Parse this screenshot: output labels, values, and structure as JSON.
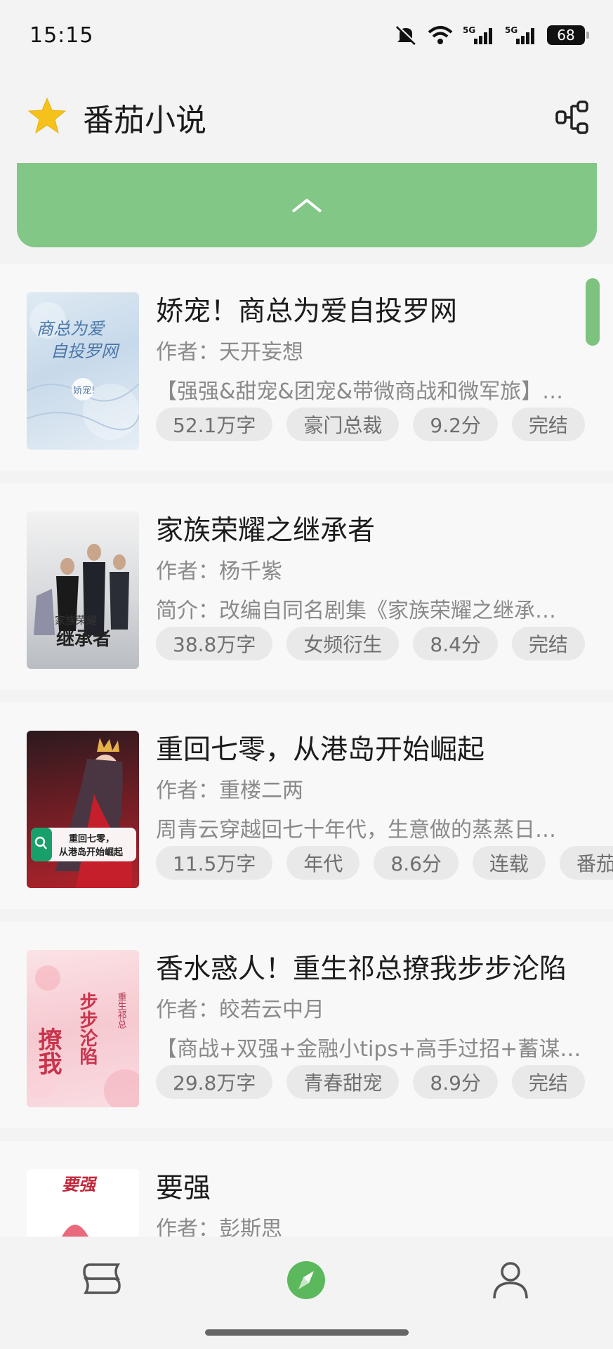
{
  "status_bar": {
    "time": "15:15",
    "battery": "68",
    "network_label_1": "5G",
    "network_label_2": "5G"
  },
  "header": {
    "app_title": "番茄小说",
    "logo_icon": "star-icon",
    "share_icon": "share-icon"
  },
  "banner": {
    "icon": "chevron-up-icon"
  },
  "books": [
    {
      "title": "娇宠！商总为爱自投罗网",
      "author": "作者：天开妄想",
      "description": "【强强&甜宠&团宠&带微商战和微军旅】…",
      "tags": [
        "52.1万字",
        "豪门总裁",
        "9.2分",
        "完结"
      ],
      "cover_text_1": "商总为爱",
      "cover_text_2": "自投罗网",
      "cover_text_3": "娇宠!"
    },
    {
      "title": "家族荣耀之继承者",
      "author": "作者：杨千紫",
      "description": "简介：改编自同名剧集《家族荣耀之继承…",
      "tags": [
        "38.8万字",
        "女频衍生",
        "8.4分",
        "完结"
      ],
      "cover_text_1": "家族荣耀",
      "cover_text_2": "继承者"
    },
    {
      "title": "重回七零，从港岛开始崛起",
      "author": "作者：重楼二两",
      "description": "周青云穿越回七十年代，生意做的蒸蒸日…",
      "tags": [
        "11.5万字",
        "年代",
        "8.6分",
        "连载",
        "番茄"
      ],
      "cover_text_1": "重回七零，",
      "cover_text_2": "从港岛开始崛起"
    },
    {
      "title": "香水惑人！重生祁总撩我步步沦陷",
      "author": "作者：皎若云中月",
      "description": "【商战+双强+金融小tips+高手过招+蓄谋…",
      "tags": [
        "29.8万字",
        "青春甜宠",
        "8.9分",
        "完结"
      ],
      "cover_text_1": "撩我",
      "cover_text_2": "步步沦陷",
      "cover_text_3": "重生祁总"
    },
    {
      "title": "要强",
      "author": "作者：彭斯思",
      "description": "",
      "tags": [],
      "cover_text_1": "要强"
    }
  ],
  "bottom_nav": [
    {
      "icon": "bookshelf-icon"
    },
    {
      "icon": "compass-icon"
    },
    {
      "icon": "profile-icon"
    }
  ],
  "colors": {
    "accent": "#82c785",
    "star": "#f5c21b",
    "compass": "#5cb85c"
  }
}
